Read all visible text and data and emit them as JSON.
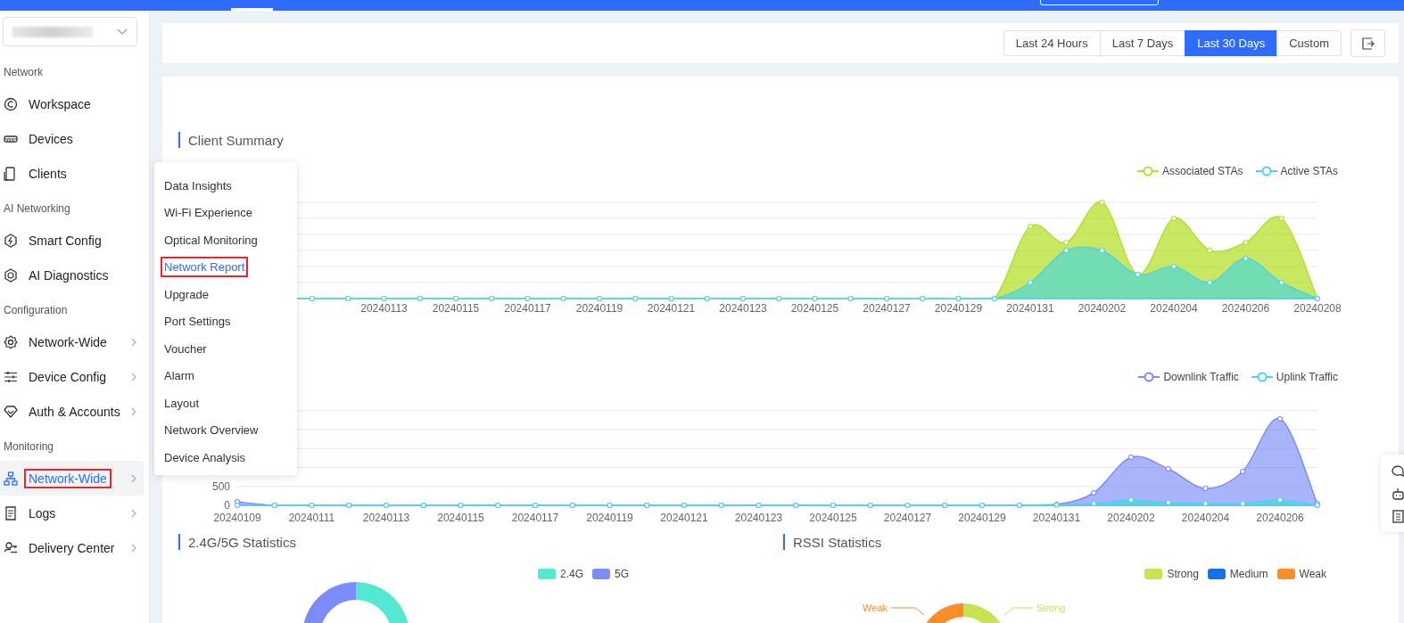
{
  "sidebar": {
    "sections": [
      {
        "label": "Network",
        "items": [
          {
            "label": "Workspace",
            "expandable": false,
            "selected": false,
            "annotated": false
          },
          {
            "label": "Devices",
            "expandable": false,
            "selected": false,
            "annotated": false
          },
          {
            "label": "Clients",
            "expandable": false,
            "selected": false,
            "annotated": false
          }
        ]
      },
      {
        "label": "AI Networking",
        "items": [
          {
            "label": "Smart Config",
            "expandable": false,
            "selected": false,
            "annotated": false
          },
          {
            "label": "AI Diagnostics",
            "expandable": false,
            "selected": false,
            "annotated": false
          }
        ]
      },
      {
        "label": "Configuration",
        "items": [
          {
            "label": "Network-Wide",
            "expandable": true,
            "selected": false,
            "annotated": false
          },
          {
            "label": "Device Config",
            "expandable": true,
            "selected": false,
            "annotated": false
          },
          {
            "label": "Auth & Accounts",
            "expandable": true,
            "selected": false,
            "annotated": false
          }
        ]
      },
      {
        "label": "Monitoring",
        "items": [
          {
            "label": "Network-Wide",
            "expandable": true,
            "selected": true,
            "annotated": true
          },
          {
            "label": "Logs",
            "expandable": true,
            "selected": false,
            "annotated": false
          },
          {
            "label": "Delivery Center",
            "expandable": true,
            "selected": false,
            "annotated": false
          }
        ]
      }
    ]
  },
  "submenu": {
    "items": [
      {
        "label": "Data Insights",
        "selected": false,
        "annotated": false
      },
      {
        "label": "Wi-Fi Experience",
        "selected": false,
        "annotated": false
      },
      {
        "label": "Optical Monitoring",
        "selected": false,
        "annotated": false
      },
      {
        "label": "Network Report",
        "selected": true,
        "annotated": true
      },
      {
        "label": "Upgrade",
        "selected": false,
        "annotated": false
      },
      {
        "label": "Port Settings",
        "selected": false,
        "annotated": false
      },
      {
        "label": "Voucher",
        "selected": false,
        "annotated": false
      },
      {
        "label": "Alarm",
        "selected": false,
        "annotated": false
      },
      {
        "label": "Layout",
        "selected": false,
        "annotated": false
      },
      {
        "label": "Network Overview",
        "selected": false,
        "annotated": false
      },
      {
        "label": "Device Analysis",
        "selected": false,
        "annotated": false
      }
    ]
  },
  "date_range": {
    "options": [
      {
        "label": "Last 24 Hours",
        "selected": false
      },
      {
        "label": "Last 7 Days",
        "selected": false
      },
      {
        "label": "Last 30 Days",
        "selected": true
      },
      {
        "label": "Custom",
        "selected": false
      }
    ]
  },
  "client_summary": {
    "title": "Client Summary",
    "legend": [
      {
        "label": "Associated STAs",
        "color": "#b5e02c"
      },
      {
        "label": "Active STAs",
        "color": "#4dd4e8"
      }
    ],
    "x_labels": [
      "20240113",
      "20240115",
      "20240117",
      "20240119",
      "20240121",
      "20240123",
      "20240125",
      "20240127",
      "20240129",
      "20240131",
      "20240202",
      "20240204",
      "20240206",
      "20240208"
    ]
  },
  "traffic": {
    "legend": [
      {
        "label": "Downlink Traffic",
        "color": "#7b8cf8"
      },
      {
        "label": "Uplink Traffic",
        "color": "#4dd4e8"
      }
    ],
    "y_labels": [
      "500",
      "0"
    ],
    "x_labels": [
      "20240109",
      "20240111",
      "20240113",
      "20240115",
      "20240117",
      "20240119",
      "20240121",
      "20240123",
      "20240125",
      "20240127",
      "20240129",
      "20240131",
      "20240202",
      "20240204",
      "20240206"
    ]
  },
  "band_statistics": {
    "title": "2.4G/5G Statistics",
    "legend": [
      {
        "label": "2.4G",
        "color": "#52e8d2"
      },
      {
        "label": "5G",
        "color": "#7b8cf8"
      }
    ]
  },
  "rssi_statistics": {
    "title": "RSSI Statistics",
    "legend": [
      {
        "label": "Strong",
        "color": "#c6e452"
      },
      {
        "label": "Medium",
        "color": "#1473e6"
      },
      {
        "label": "Weak",
        "color": "#fa8c2a"
      }
    ],
    "slice_labels": [
      {
        "label": "Weak",
        "color": "#fa8c2a"
      },
      {
        "label": "Strong",
        "color": "#c6e452"
      }
    ]
  }
}
